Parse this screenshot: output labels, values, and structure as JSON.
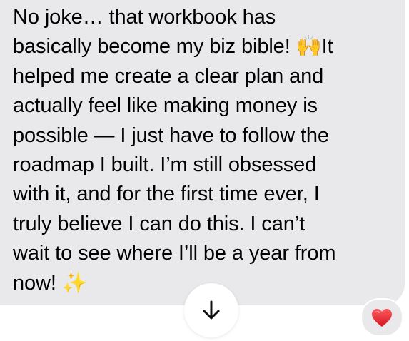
{
  "message": {
    "text": "No joke… that workbook has\nbasically become my biz bible! 🙌It\nhelped me create a clear plan and\nactually feel like making money is\npossible — I just have to follow the\nroadmap I built. I’m still obsessed\nwith it, and for the first time ever, I\ntruly believe I can do this. I can’t\nwait to see where I’ll be a year from\nnow! ✨",
    "bubble_color": "#e9e9eb"
  },
  "scroll_button": {
    "icon": "arrow-down-icon"
  },
  "reaction": {
    "icon": "heart-icon",
    "color": "#e0242f"
  }
}
